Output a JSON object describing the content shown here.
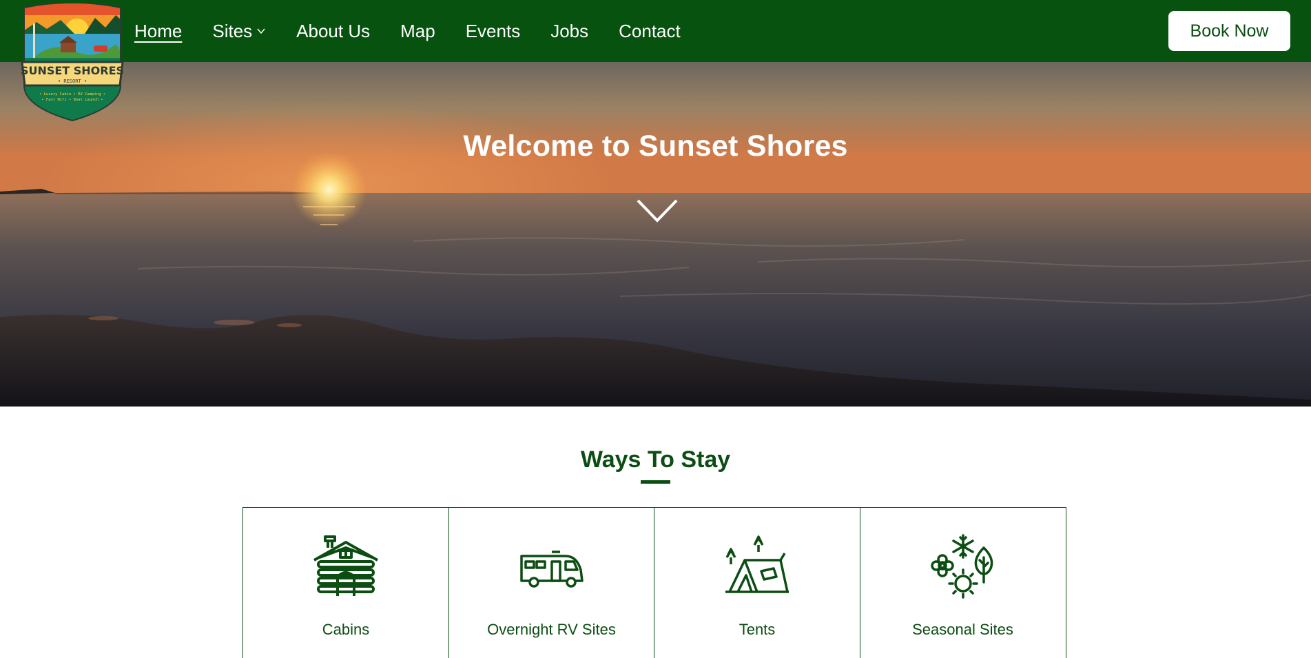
{
  "brand": {
    "logo_title": "SUNSET SHORES",
    "logo_subtitle": "RESORT",
    "logo_tagline_1": "• Luxury Cabin • RV Camping •",
    "logo_tagline_2": "• Fast Wifi • Boat Launch •"
  },
  "nav": {
    "items": [
      {
        "label": "Home",
        "active": true
      },
      {
        "label": "Sites",
        "has_dropdown": true
      },
      {
        "label": "About Us"
      },
      {
        "label": "Map"
      },
      {
        "label": "Events"
      },
      {
        "label": "Jobs"
      },
      {
        "label": "Contact"
      }
    ],
    "book_button": "Book Now"
  },
  "hero": {
    "title": "Welcome to Sunset Shores",
    "scroll_icon": "chevron-down-icon"
  },
  "stays": {
    "title": "Ways To Stay",
    "cards": [
      {
        "label": "Cabins",
        "icon": "log-cabin-icon"
      },
      {
        "label": "Overnight RV Sites",
        "icon": "rv-icon"
      },
      {
        "label": "Tents",
        "icon": "tent-icon"
      },
      {
        "label": "Seasonal Sites",
        "icon": "seasons-icon"
      }
    ]
  },
  "colors": {
    "primary_green": "#07520f",
    "text_green": "#0b4d12",
    "white": "#ffffff"
  }
}
